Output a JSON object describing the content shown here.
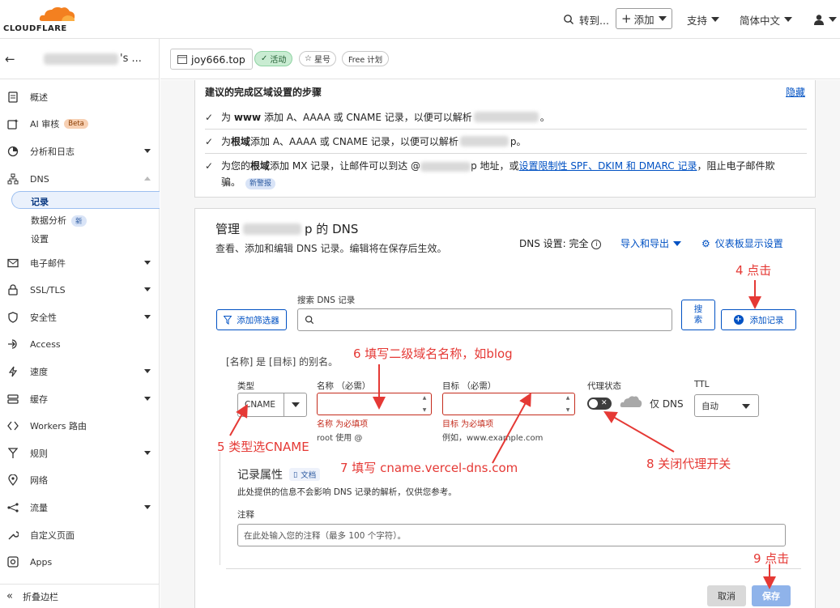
{
  "topbar": {
    "logo_text": "CLOUDFLARE",
    "goto": "转到...",
    "add": "添加",
    "support": "支持",
    "language": "简体中文"
  },
  "sidebar": {
    "account_suffix": "'s ...",
    "items": [
      {
        "label": "概述",
        "icon": "document-icon"
      },
      {
        "label": "AI 审核",
        "badge": "Beta",
        "icon": "ai-icon"
      },
      {
        "label": "分析和日志",
        "icon": "chart-icon"
      },
      {
        "label": "DNS",
        "icon": "network-icon"
      },
      {
        "label": "电子邮件",
        "icon": "mail-icon"
      },
      {
        "label": "SSL/TLS",
        "icon": "lock-icon"
      },
      {
        "label": "安全性",
        "icon": "shield-icon"
      },
      {
        "label": "Access",
        "icon": "access-icon"
      },
      {
        "label": "速度",
        "icon": "bolt-icon"
      },
      {
        "label": "缓存",
        "icon": "cache-icon"
      },
      {
        "label": "Workers 路由",
        "icon": "workers-icon"
      },
      {
        "label": "规则",
        "icon": "rules-icon"
      },
      {
        "label": "网络",
        "icon": "location-icon"
      },
      {
        "label": "流量",
        "icon": "traffic-icon"
      },
      {
        "label": "自定义页面",
        "icon": "wrench-icon"
      },
      {
        "label": "Apps",
        "icon": "apps-icon"
      }
    ],
    "dns_sub": {
      "records": "记录",
      "analytics": "数据分析",
      "analytics_badge": "新",
      "settings": "设置"
    },
    "collapse": "折叠边栏"
  },
  "zone": {
    "domain": "joy666.top",
    "status": "活动",
    "star": "星号",
    "plan": "Free 计划"
  },
  "setup": {
    "title": "建议的完成区域设置的步骤",
    "hide": "隐藏",
    "step1_a": "为",
    "step1_b": "www",
    "step1_c": "添加 A、AAAA 或 CNAME 记录，以便可以解析",
    "step1_d": "。",
    "step2_a": "为",
    "step2_b": "根域",
    "step2_c": "添加 A、AAAA 或 CNAME 记录，以便可以解析",
    "step2_d": "p。",
    "step3_a": "为您的",
    "step3_b": "根域",
    "step3_c": "添加 MX 记录，让邮件可以到达 @",
    "step3_d": "p 地址，或",
    "step3_link": "设置限制性 SPF、DKIM 和 DMARC 记录",
    "step3_e": "，阻止电子邮件欺",
    "step3_f": "骗。",
    "step3_badge": "新警报"
  },
  "dns": {
    "title_prefix": "管理",
    "title_suffix": "p 的 DNS",
    "desc": "查看、添加和编辑 DNS 记录。编辑将在保存后生效。",
    "setting_label": "DNS 设置:",
    "setting_value": "完全",
    "import_export": "导入和导出",
    "dashboard_settings": "仪表板显示设置",
    "filter_button": "添加筛选器",
    "search_label": "搜索 DNS 记录",
    "search_button_1": "搜",
    "search_button_2": "索",
    "add_record": "添加记录",
    "alias_note": "[名称] 是 [目标] 的别名。",
    "type_label": "类型",
    "type_value": "CNAME",
    "name_label": "名称 （必需）",
    "name_error": "名称 为必填项",
    "name_hint": "root 使用 @",
    "target_label": "目标 （必需）",
    "target_error": "目标 为必填项",
    "target_hint": "例如，www.example.com",
    "proxy_label": "代理状态",
    "dns_only": "仅 DNS",
    "ttl_label": "TTL",
    "ttl_value": "自动",
    "record_attrs": "记录属性",
    "doc": "文档",
    "record_desc": "此处提供的信息不会影响 DNS 记录的解析，仅供您参考。",
    "note_label": "注释",
    "note_placeholder": "在此处输入您的注释（最多 100 个字符）。",
    "cancel": "取消",
    "save": "保存"
  },
  "annotations": {
    "a4": "4 点击",
    "a5": "5 类型选CNAME",
    "a6": "6 填写二级域名名称，如blog",
    "a7": "7 填写   cname.vercel-dns.com",
    "a8": "8 关闭代理开关",
    "a9": "9 点击"
  },
  "colors": {
    "accent": "#0051c3",
    "error": "#c42b1c",
    "annotation": "#e53935",
    "brand_orange": "#f38020"
  }
}
